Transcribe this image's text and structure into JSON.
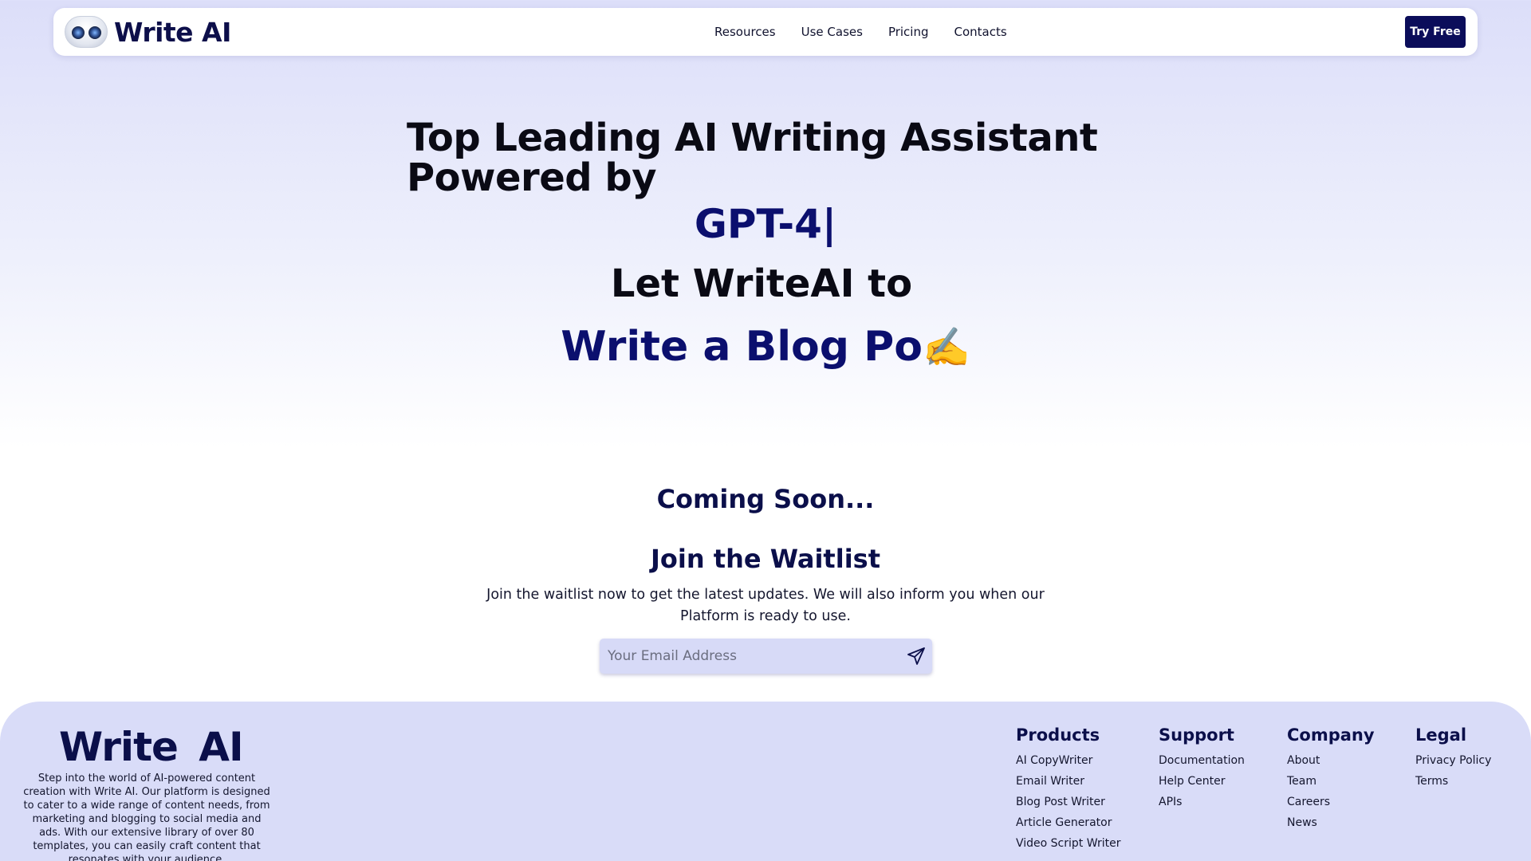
{
  "nav": {
    "logo_text": "Write AI",
    "links": [
      "Resources",
      "Use Cases",
      "Pricing",
      "Contacts"
    ],
    "cta": "Try Free"
  },
  "hero": {
    "title": "Top Leading AI Writing Assistant Powered by",
    "rotating_text": "GPT-4|",
    "let_line": "Let WriteAI to",
    "write_line": "Write a Blog Po",
    "write_emoji": "✍️"
  },
  "waitlist": {
    "coming_soon": "Coming Soon...",
    "title": "Join the Waitlist",
    "description": "Join the waitlist now to get the latest updates. We will also inform you when our Platform is ready to use.",
    "email_placeholder": "Your Email Address",
    "send_icon": "paper-plane-icon"
  },
  "footer": {
    "logo_text": "Write AI",
    "description": "Step into the world of AI-powered content creation with Write AI. Our platform is designed to cater to a wide range of content needs, from marketing and blogging to social media and ads. With our extensive library of over 80 templates, you can easily craft content that resonates with your audience.",
    "columns": [
      {
        "title": "Products",
        "links": [
          "AI CopyWriter",
          "Email Writer",
          "Blog Post Writer",
          "Article Generator",
          "Video Script Writer"
        ]
      },
      {
        "title": "Support",
        "links": [
          "Documentation",
          "Help Center",
          "APIs"
        ]
      },
      {
        "title": "Company",
        "links": [
          "About",
          "Team",
          "Careers",
          "News"
        ]
      },
      {
        "title": "Legal",
        "links": [
          "Privacy Policy",
          "Terms"
        ]
      }
    ]
  },
  "colors": {
    "brand_navy": "#0b0f4a",
    "accent_blue": "#0b0f6e",
    "button_bg": "#0b0d5a",
    "footer_bg": "#d9dcf8"
  }
}
